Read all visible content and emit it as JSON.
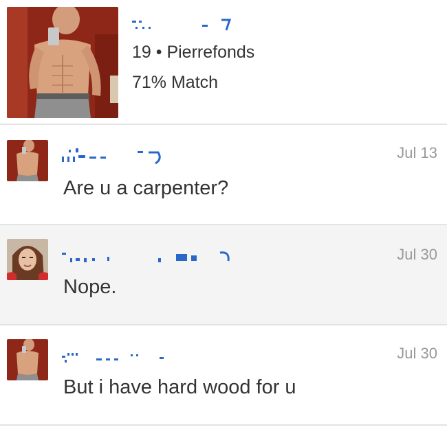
{
  "profile": {
    "age_city": "19 • Pierrefonds",
    "match": "71% Match"
  },
  "messages": [
    {
      "date": "Jul 13",
      "text": "Are u a carpenter?",
      "avatar": "shirtless-man-selfie"
    },
    {
      "date": "Jul 30",
      "text": "Nope.",
      "avatar": "woman-selfie"
    },
    {
      "date": "Jul 30",
      "text": "But i have hard wood for u",
      "avatar": "shirtless-man-selfie"
    }
  ],
  "colors": {
    "name_link": "#2a67c8",
    "date_text": "#999999",
    "highlight_row": "#f4f4f4",
    "divider": "#e3e3e3"
  }
}
